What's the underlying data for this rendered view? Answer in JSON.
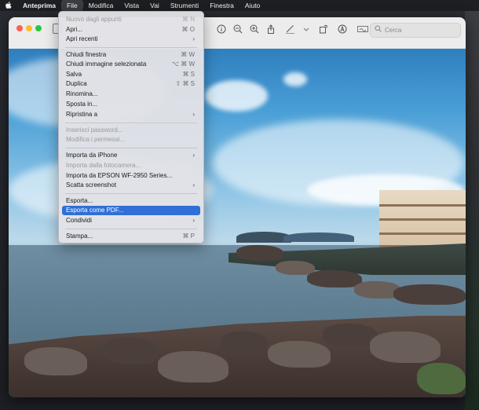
{
  "menubar": {
    "apple": "",
    "app": "Anteprima",
    "items": [
      "File",
      "Modifica",
      "Vista",
      "Vai",
      "Strumenti",
      "Finestra",
      "Aiuto"
    ]
  },
  "toolbar": {
    "search_placeholder": "Cerca"
  },
  "file_menu": [
    {
      "label": "Nuovo dagli appunti",
      "shortcut": "⌘ N",
      "enabled": false
    },
    {
      "label": "Apri...",
      "shortcut": "⌘ O",
      "enabled": true
    },
    {
      "label": "Apri recenti",
      "submenu": true,
      "enabled": true
    },
    {
      "label": "Chiudi finestra",
      "shortcut": "⌘ W",
      "enabled": true
    },
    {
      "label": "Chiudi immagine selezionata",
      "shortcut": "⌥ ⌘ W",
      "enabled": true
    },
    {
      "label": "Salva",
      "shortcut": "⌘ S",
      "enabled": true
    },
    {
      "label": "Duplica",
      "shortcut": "⇧ ⌘ S",
      "enabled": true
    },
    {
      "label": "Rinomina...",
      "enabled": true
    },
    {
      "label": "Sposta in...",
      "enabled": true
    },
    {
      "label": "Ripristina a",
      "submenu": true,
      "enabled": true
    },
    {
      "label": "Inserisci password...",
      "enabled": false
    },
    {
      "label": "Modifica i permessi...",
      "enabled": false
    },
    {
      "label": "Importa da iPhone",
      "submenu": true,
      "enabled": true
    },
    {
      "label": "Importa dalla fotocamera...",
      "enabled": false
    },
    {
      "label": "Importa da EPSON WF-2950 Series...",
      "enabled": true
    },
    {
      "label": "Scatta screenshot",
      "submenu": true,
      "enabled": true
    },
    {
      "label": "Esporta...",
      "enabled": true
    },
    {
      "label": "Esporta come PDF...",
      "enabled": true,
      "highlighted": true
    },
    {
      "label": "Condividi",
      "submenu": true,
      "enabled": true
    },
    {
      "label": "Stampa...",
      "shortcut": "⌘ P",
      "enabled": true
    }
  ],
  "colors": {
    "highlight": "#2f6fd6",
    "menubar": "#1e1f22"
  }
}
